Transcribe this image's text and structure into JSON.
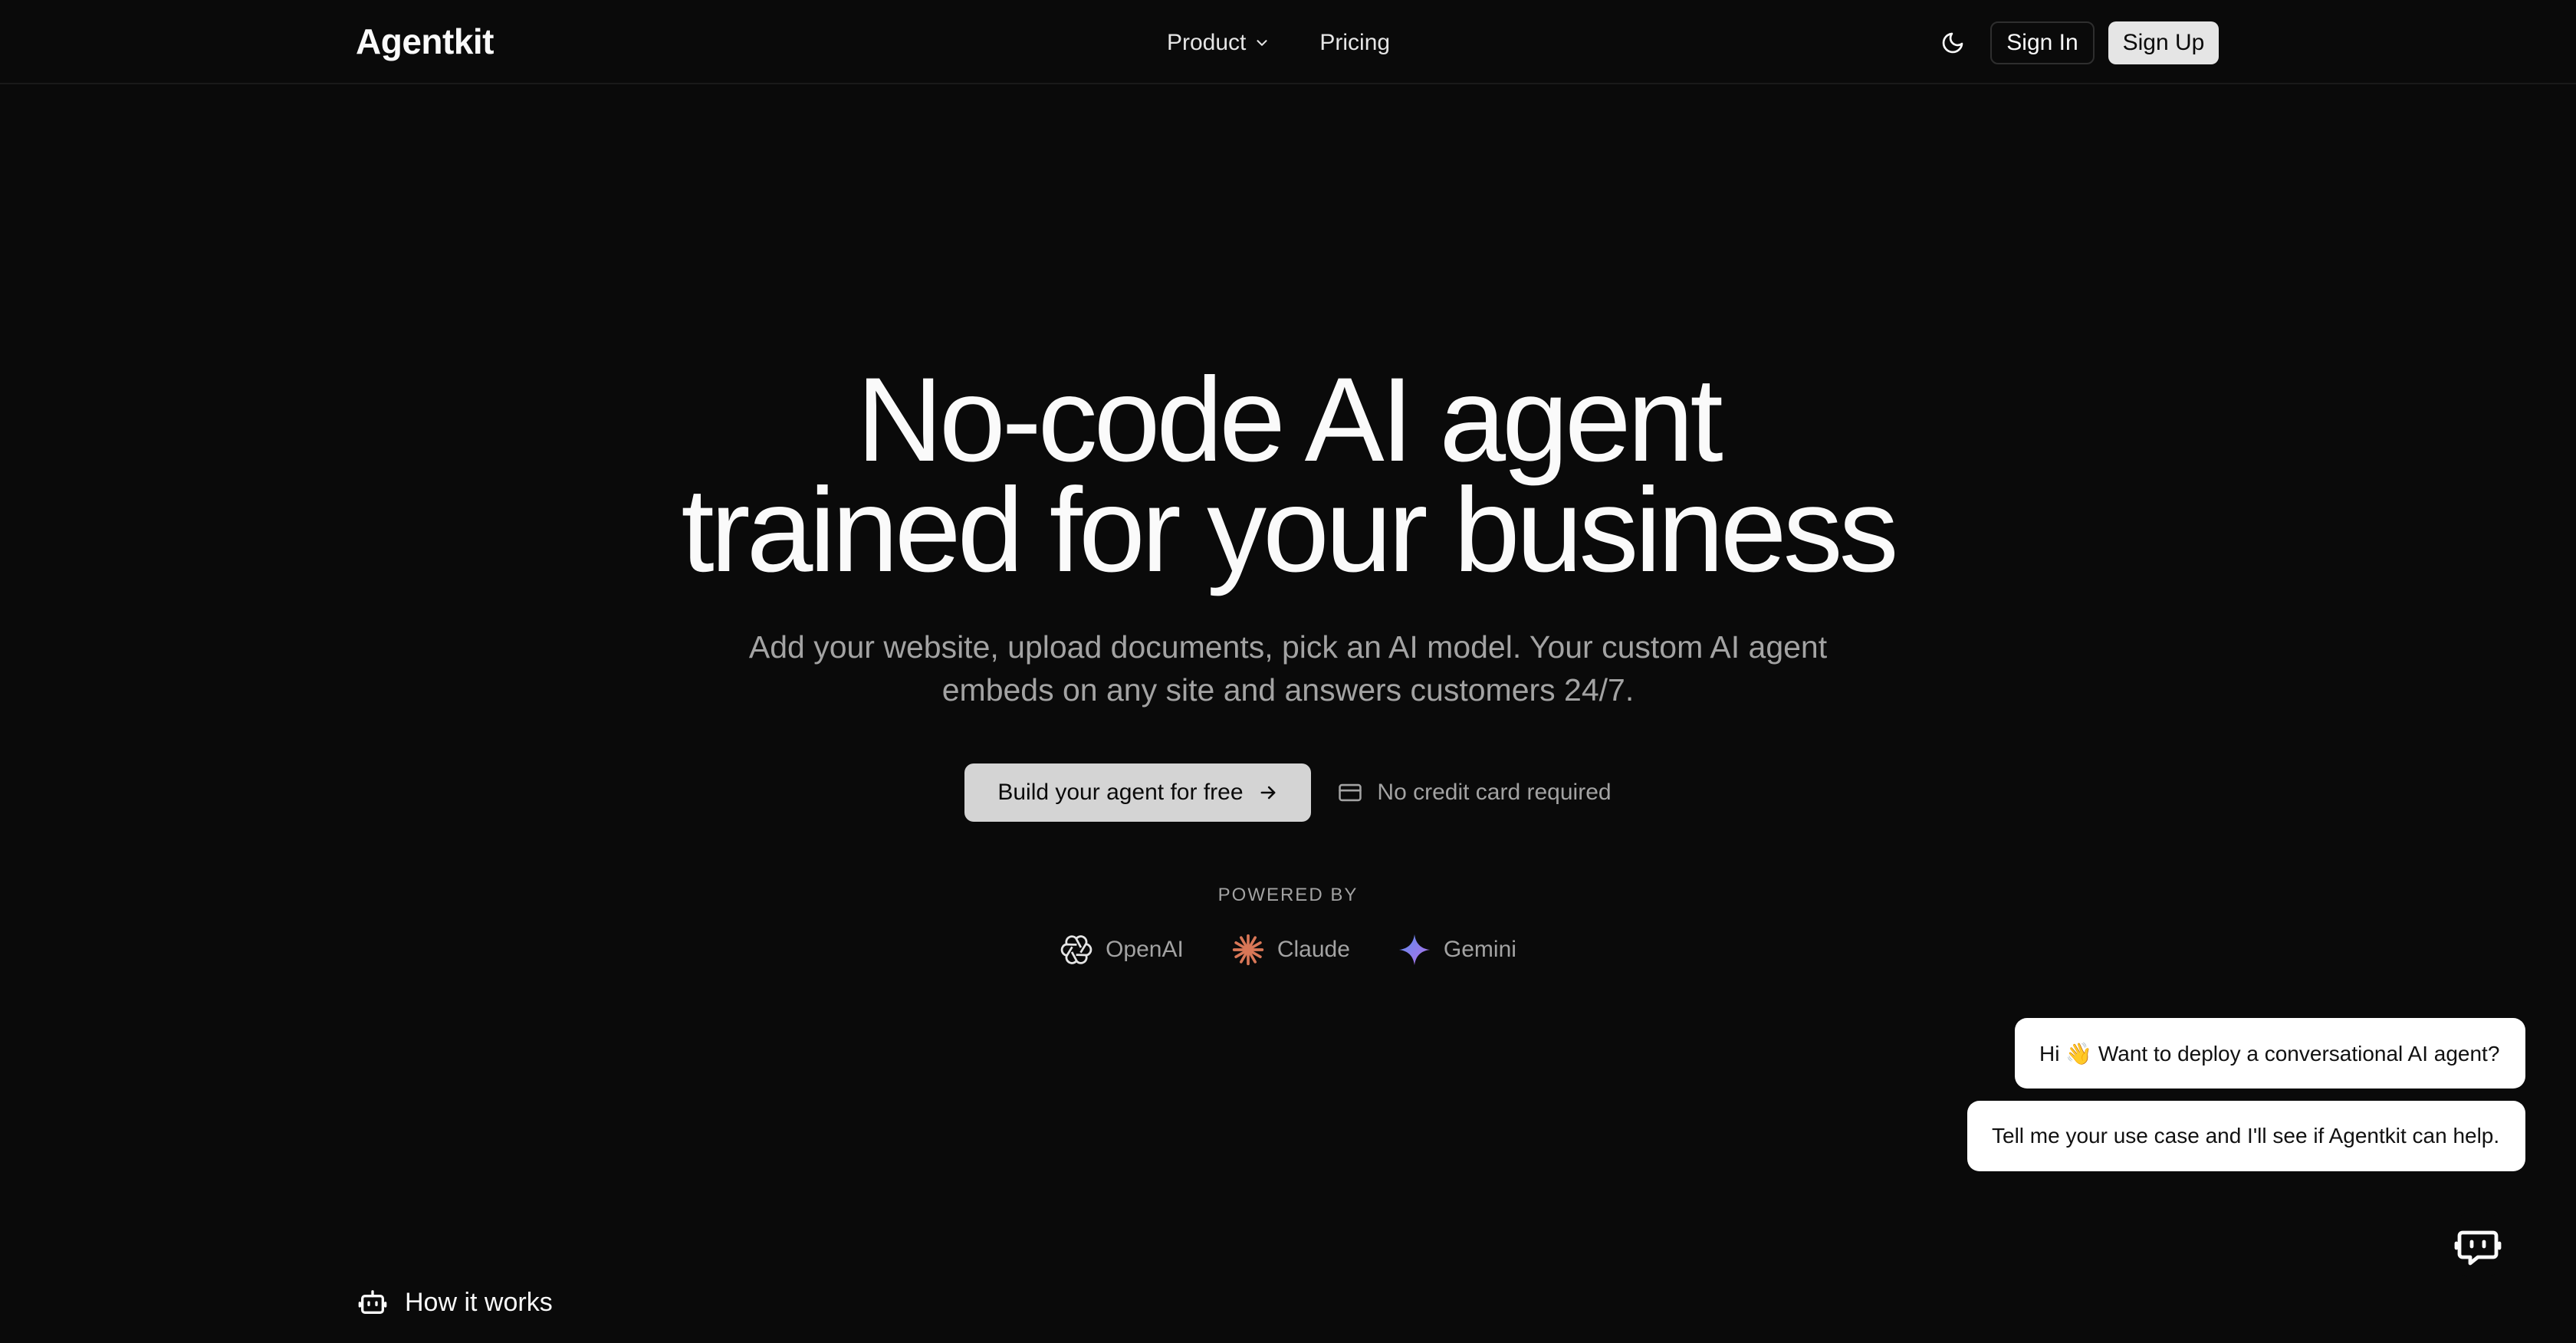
{
  "header": {
    "logo": "Agentkit",
    "nav": {
      "product": "Product",
      "pricing": "Pricing"
    },
    "sign_in": "Sign In",
    "sign_up": "Sign Up"
  },
  "hero": {
    "title_line1": "No-code AI agent",
    "title_line2": "trained for your business",
    "subtitle_line1": "Add your website, upload documents, pick an AI model. Your custom AI agent",
    "subtitle_line2": "embeds on any site and answers customers 24/7.",
    "cta": "Build your agent for free",
    "no_card": "No credit card required"
  },
  "powered_by": {
    "label": "POWERED BY",
    "providers": [
      "OpenAI",
      "Claude",
      "Gemini"
    ]
  },
  "chat": {
    "messages": [
      "Hi 👋 Want to deploy a conversational AI agent?",
      "Tell me your use case and I'll see if Agentkit can help."
    ]
  },
  "section": {
    "how_it_works": "How it works"
  },
  "colors": {
    "background": "#0a0a0a",
    "text": "#fafafa",
    "muted": "#a3a3a3",
    "cta_bg": "#d4d4d4",
    "claude_accent": "#d97757",
    "gemini_accent": "#8e75f0"
  }
}
